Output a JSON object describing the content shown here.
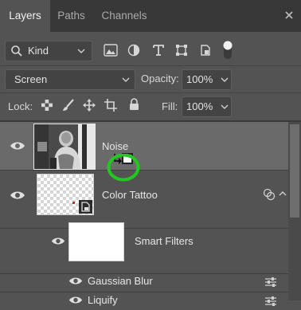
{
  "tabs": [
    {
      "label": "Layers",
      "active": true
    },
    {
      "label": "Paths",
      "active": false
    },
    {
      "label": "Channels",
      "active": false
    }
  ],
  "filter": {
    "kind_label": "Kind"
  },
  "blend": {
    "mode": "Screen",
    "opacity_label": "Opacity:",
    "opacity_value": "100%"
  },
  "lock": {
    "label": "Lock:",
    "fill_label": "Fill:",
    "fill_value": "100%"
  },
  "layers": [
    {
      "name": "Noise",
      "selected": true
    },
    {
      "name": "Color Tattoo",
      "selected": false
    },
    {
      "name": "Smart Filters"
    },
    {
      "name": "Gaussian Blur"
    },
    {
      "name": "Liquify"
    }
  ],
  "colors": {
    "highlight_ring": "#22c71f",
    "panel": "#535353",
    "selected_row": "#6a6a6a"
  }
}
